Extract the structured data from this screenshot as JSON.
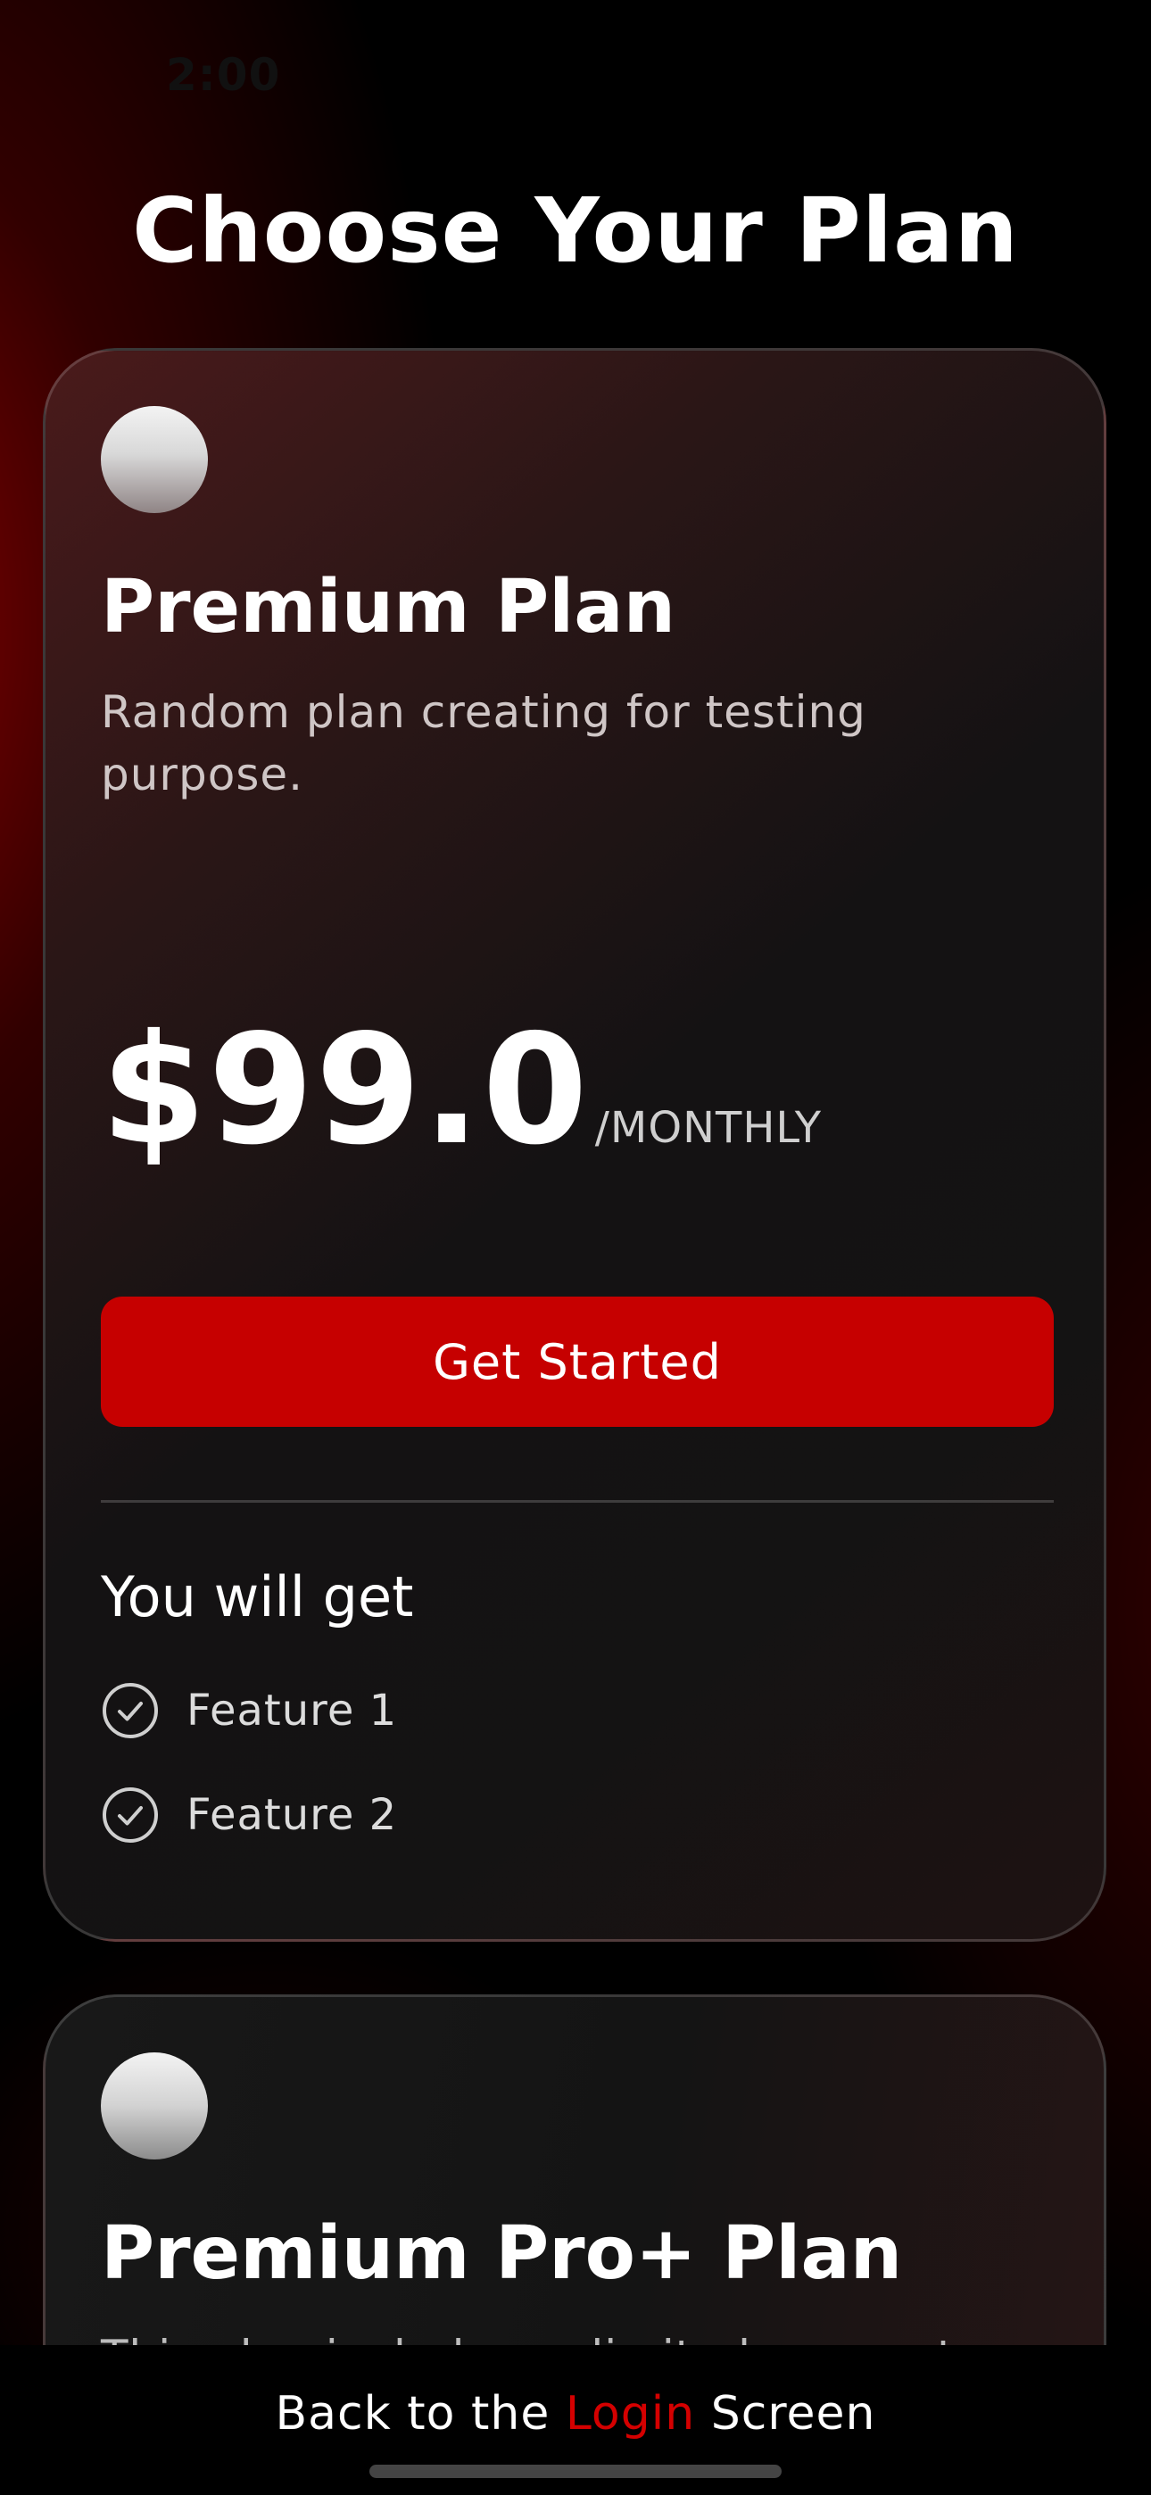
{
  "status_bar": {
    "time": "2:00"
  },
  "page": {
    "title": "Choose Your Plan"
  },
  "plans": [
    {
      "name": "Premium Plan",
      "description": "Random plan creating for testing purpose.",
      "price": "$99.0",
      "period": "/MONTHLY",
      "cta_label": "Get Started",
      "benefits_heading": "You will get",
      "features": [
        "Feature 1",
        "Feature 2"
      ]
    },
    {
      "name": "Premium Pro+ Plan",
      "description": "This plan includes unlimited access to all"
    }
  ],
  "footer": {
    "prefix": "Back to the ",
    "link_label": "Login",
    "suffix": " Screen"
  },
  "colors": {
    "accent": "#c60000",
    "link": "#d40000",
    "background": "#000000"
  },
  "icons": {
    "feature_check": "check-circle-icon"
  }
}
